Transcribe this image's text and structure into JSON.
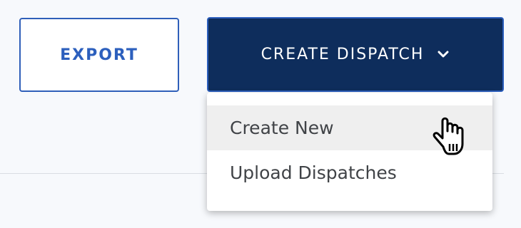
{
  "toolbar": {
    "export_label": "EXPORT",
    "create_dispatch_label": "CREATE DISPATCH",
    "create_dispatch_icon": "chevron-down-icon"
  },
  "dropdown": {
    "items": [
      {
        "label": "Create New",
        "state": "hovered"
      },
      {
        "label": "Upload Dispatches"
      }
    ]
  },
  "cursor": {
    "icon": "hand-pointer-icon"
  },
  "colors": {
    "primary_dark": "#0e2d5c",
    "accent_blue": "#2c5fbd",
    "background": "#f7f9fc",
    "menu_hover": "#efefef",
    "menu_text": "#404347"
  }
}
